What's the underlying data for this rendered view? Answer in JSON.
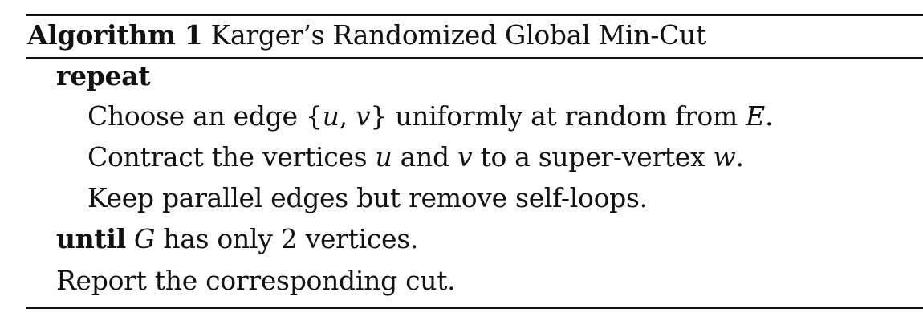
{
  "algorithm": {
    "caption_label": "Algorithm 1",
    "caption_title": "Karger’s Randomized Global Min-Cut",
    "lines": [
      {
        "keyword": "repeat"
      },
      {
        "text_before": "Choose an edge ",
        "math_open": "{",
        "math_var1": "u",
        "math_sep": ", ",
        "math_var2": "v",
        "math_close": "}",
        "text_mid": " uniformly at random from ",
        "math_set": "E",
        "text_end": "."
      },
      {
        "text_before": "Contract the vertices ",
        "math_u": "u",
        "text_and": " and ",
        "math_v": "v",
        "text_to": " to a super-vertex ",
        "math_w": "w",
        "text_end": "."
      },
      {
        "text": "Keep parallel edges but remove self-loops."
      },
      {
        "keyword": "until",
        "math_g": "G",
        "text": " has only 2 vertices."
      },
      {
        "text": "Report the corresponding cut."
      }
    ]
  }
}
